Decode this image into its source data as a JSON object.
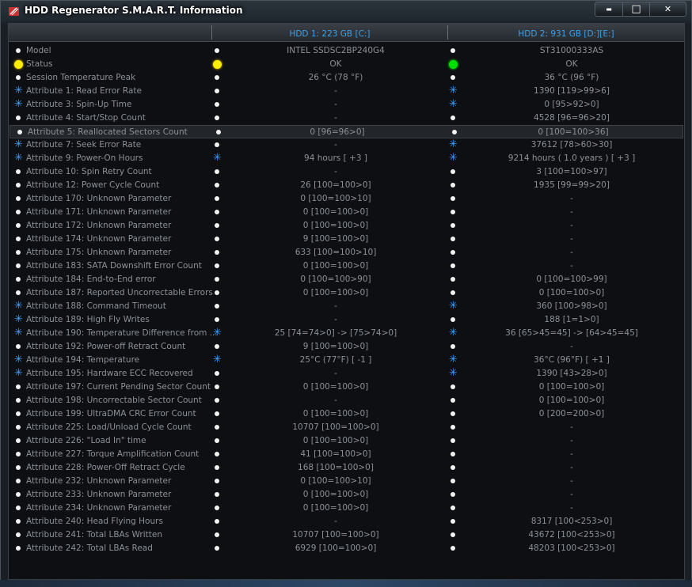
{
  "window": {
    "title": "HDD Regenerator S.M.A.R.T. Information",
    "controls": {
      "minimize": "▬",
      "maximize": "□",
      "close": "✕"
    }
  },
  "header": {
    "hdd1": "HDD 1: 223 GB [C:]",
    "hdd2": "HDD 2: 931 GB [D:][E:]"
  },
  "rows": [
    {
      "label": "Model",
      "i0": "dot",
      "i1": "dot",
      "v1": "INTEL SSDSC2BP240G4",
      "i2": "dot",
      "v2": "ST31000333AS"
    },
    {
      "label": "Status",
      "i0": "yellow",
      "i1": "yellow",
      "v1": "OK",
      "i2": "green",
      "v2": "OK"
    },
    {
      "label": "Session Temperature Peak",
      "i0": "dot",
      "i1": "dot",
      "v1": "26 °C (78 °F)",
      "i2": "dot",
      "v2": "36 °C (96 °F)"
    },
    {
      "label": "Attribute 1: Read Error Rate",
      "i0": "star",
      "i1": "dot",
      "v1": "-",
      "i2": "star",
      "v2": "1390  [119>99>6]"
    },
    {
      "label": "Attribute 3: Spin-Up Time",
      "i0": "star",
      "i1": "dot",
      "v1": "-",
      "i2": "star",
      "v2": "0  [95>92>0]"
    },
    {
      "label": "Attribute 4: Start/Stop Count",
      "i0": "dot",
      "i1": "dot",
      "v1": "-",
      "i2": "dot",
      "v2": "4528  [96=96>20]"
    },
    {
      "label": "Attribute 5: Reallocated Sectors Count",
      "i0": "dot",
      "i1": "dot",
      "v1": "0  [96=96>0]",
      "i2": "dot",
      "v2": "0  [100=100>36]",
      "selected": true
    },
    {
      "label": "Attribute 7: Seek Error Rate",
      "i0": "star",
      "i1": "dot",
      "v1": "-",
      "i2": "star",
      "v2": "37612  [78>60>30]"
    },
    {
      "label": "Attribute 9: Power-On Hours",
      "i0": "star",
      "i1": "star",
      "v1": "94 hours  [ +3 ]",
      "i2": "star",
      "v2": "9214 hours ( 1.0 years )  [ +3 ]"
    },
    {
      "label": "Attribute 10: Spin Retry Count",
      "i0": "dot",
      "i1": "dot",
      "v1": "-",
      "i2": "dot",
      "v2": "3  [100=100>97]"
    },
    {
      "label": "Attribute 12: Power Cycle Count",
      "i0": "dot",
      "i1": "dot",
      "v1": "26  [100=100>0]",
      "i2": "dot",
      "v2": "1935  [99=99>20]"
    },
    {
      "label": "Attribute 170: Unknown Parameter",
      "i0": "dot",
      "i1": "dot",
      "v1": "0  [100=100>10]",
      "i2": "dot",
      "v2": "-"
    },
    {
      "label": "Attribute 171: Unknown Parameter",
      "i0": "dot",
      "i1": "dot",
      "v1": "0  [100=100>0]",
      "i2": "dot",
      "v2": "-"
    },
    {
      "label": "Attribute 172: Unknown Parameter",
      "i0": "dot",
      "i1": "dot",
      "v1": "0  [100=100>0]",
      "i2": "dot",
      "v2": "-"
    },
    {
      "label": "Attribute 174: Unknown Parameter",
      "i0": "dot",
      "i1": "dot",
      "v1": "9  [100=100>0]",
      "i2": "dot",
      "v2": "-"
    },
    {
      "label": "Attribute 175: Unknown Parameter",
      "i0": "dot",
      "i1": "dot",
      "v1": "633  [100=100>10]",
      "i2": "dot",
      "v2": "-"
    },
    {
      "label": "Attribute 183: SATA Downshift Error Count",
      "i0": "dot",
      "i1": "dot",
      "v1": "0  [100=100>0]",
      "i2": "dot",
      "v2": "-"
    },
    {
      "label": "Attribute 184: End-to-End error",
      "i0": "dot",
      "i1": "dot",
      "v1": "0  [100=100>90]",
      "i2": "dot",
      "v2": "0  [100=100>99]"
    },
    {
      "label": "Attribute 187: Reported Uncorrectable Errors",
      "i0": "dot",
      "i1": "dot",
      "v1": "0  [100=100>0]",
      "i2": "dot",
      "v2": "0  [100=100>0]"
    },
    {
      "label": "Attribute 188: Command Timeout",
      "i0": "star",
      "i1": "dot",
      "v1": "-",
      "i2": "star",
      "v2": "360  [100>98>0]"
    },
    {
      "label": "Attribute 189: High Fly Writes",
      "i0": "star",
      "i1": "dot",
      "v1": "-",
      "i2": "dot",
      "v2": "188  [1=1>0]"
    },
    {
      "label": "Attribute 190: Temperature Difference from ...",
      "i0": "star",
      "i1": "star",
      "v1": "25  [74=74>0] -> [75>74>0]",
      "i2": "star",
      "v2": "36  [65>45=45] -> [64>45=45]"
    },
    {
      "label": "Attribute 192: Power-off Retract Count",
      "i0": "dot",
      "i1": "dot",
      "v1": "9  [100=100>0]",
      "i2": "dot",
      "v2": "-"
    },
    {
      "label": "Attribute 194: Temperature",
      "i0": "star",
      "i1": "star",
      "v1": "25°C (77°F)  [ -1 ]",
      "i2": "star",
      "v2": "36°C (96°F)  [ +1 ]"
    },
    {
      "label": "Attribute 195: Hardware ECC Recovered",
      "i0": "star",
      "i1": "dot",
      "v1": "-",
      "i2": "star",
      "v2": "1390  [43>28>0]"
    },
    {
      "label": "Attribute 197: Current Pending Sector Count",
      "i0": "dot",
      "i1": "dot",
      "v1": "0  [100=100>0]",
      "i2": "dot",
      "v2": "0  [100=100>0]"
    },
    {
      "label": "Attribute 198: Uncorrectable Sector Count",
      "i0": "dot",
      "i1": "dot",
      "v1": "-",
      "i2": "dot",
      "v2": "0  [100=100>0]"
    },
    {
      "label": "Attribute 199: UltraDMA CRC Error Count",
      "i0": "dot",
      "i1": "dot",
      "v1": "0  [100=100>0]",
      "i2": "dot",
      "v2": "0  [200=200>0]"
    },
    {
      "label": "Attribute 225: Load/Unload Cycle Count",
      "i0": "dot",
      "i1": "dot",
      "v1": "10707  [100=100>0]",
      "i2": "dot",
      "v2": "-"
    },
    {
      "label": "Attribute 226: \"Load In\" time",
      "i0": "dot",
      "i1": "dot",
      "v1": "0  [100=100>0]",
      "i2": "dot",
      "v2": "-"
    },
    {
      "label": "Attribute 227: Torque Amplification Count",
      "i0": "dot",
      "i1": "dot",
      "v1": "41  [100=100>0]",
      "i2": "dot",
      "v2": "-"
    },
    {
      "label": "Attribute 228: Power-Off Retract Cycle",
      "i0": "dot",
      "i1": "dot",
      "v1": "168  [100=100>0]",
      "i2": "dot",
      "v2": "-"
    },
    {
      "label": "Attribute 232: Unknown Parameter",
      "i0": "dot",
      "i1": "dot",
      "v1": "0  [100=100>10]",
      "i2": "dot",
      "v2": "-"
    },
    {
      "label": "Attribute 233: Unknown Parameter",
      "i0": "dot",
      "i1": "dot",
      "v1": "0  [100=100>0]",
      "i2": "dot",
      "v2": "-"
    },
    {
      "label": "Attribute 234: Unknown Parameter",
      "i0": "dot",
      "i1": "dot",
      "v1": "0  [100=100>0]",
      "i2": "dot",
      "v2": "-"
    },
    {
      "label": "Attribute 240: Head Flying Hours",
      "i0": "dot",
      "i1": "dot",
      "v1": "-",
      "i2": "dot",
      "v2": "8317  [100<253>0]"
    },
    {
      "label": "Attribute 241: Total LBAs Written",
      "i0": "dot",
      "i1": "dot",
      "v1": "10707  [100=100>0]",
      "i2": "dot",
      "v2": "43672  [100<253>0]"
    },
    {
      "label": "Attribute 242: Total LBAs Read",
      "i0": "dot",
      "i1": "dot",
      "v1": "6929  [100=100>0]",
      "i2": "dot",
      "v2": "48203  [100<253>0]"
    }
  ]
}
